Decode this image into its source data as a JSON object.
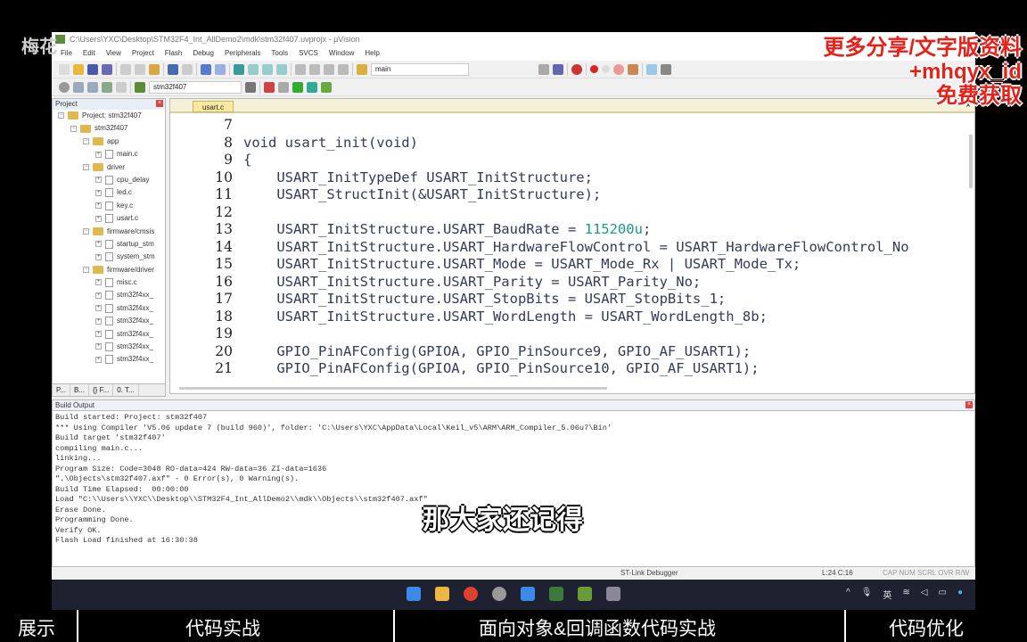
{
  "watermark": "梅花",
  "window": {
    "title": "C:\\Users\\YXC\\Desktop\\STM32F4_Int_AllDemo2\\mdk\\stm32f407.uvprojx - µVision"
  },
  "menu": [
    "File",
    "Edit",
    "View",
    "Project",
    "Flash",
    "Debug",
    "Peripherals",
    "Tools",
    "SVCS",
    "Window",
    "Help"
  ],
  "toolbar": {
    "find_combo": "main",
    "target_combo": "stm32f407"
  },
  "project": {
    "title": "Project",
    "items": [
      {
        "label": "Project: stm32f407",
        "type": "root",
        "level": 0
      },
      {
        "label": "stm32f407",
        "type": "folder",
        "level": 1
      },
      {
        "label": "app",
        "type": "folder",
        "level": 2
      },
      {
        "label": "main.c",
        "type": "file",
        "level": 3
      },
      {
        "label": "driver",
        "type": "folder",
        "level": 2
      },
      {
        "label": "cpu_delay",
        "type": "file",
        "level": 3
      },
      {
        "label": "led.c",
        "type": "file",
        "level": 3
      },
      {
        "label": "key.c",
        "type": "file",
        "level": 3
      },
      {
        "label": "usart.c",
        "type": "file",
        "level": 3
      },
      {
        "label": "firmware/cmsis",
        "type": "folder",
        "level": 2
      },
      {
        "label": "startup_stm",
        "type": "file",
        "level": 3
      },
      {
        "label": "system_stm",
        "type": "file",
        "level": 3
      },
      {
        "label": "firmware/driver",
        "type": "folder",
        "level": 2
      },
      {
        "label": "misc.c",
        "type": "file",
        "level": 3
      },
      {
        "label": "stm32f4xx_",
        "type": "file",
        "level": 3
      },
      {
        "label": "stm32f4xx_",
        "type": "file",
        "level": 3
      },
      {
        "label": "stm32f4xx_",
        "type": "file",
        "level": 3
      },
      {
        "label": "stm32f4xx_",
        "type": "file",
        "level": 3
      },
      {
        "label": "stm32f4xx_",
        "type": "file",
        "level": 3
      },
      {
        "label": "stm32f4xx_",
        "type": "file",
        "level": 3
      }
    ],
    "tabs": [
      "P...",
      "B...",
      "{} F...",
      "0. T..."
    ]
  },
  "editor": {
    "tab": "usart.c",
    "lines": [
      {
        "n": "7",
        "code": ""
      },
      {
        "n": "8",
        "code": "void usart_init(void)"
      },
      {
        "n": "9",
        "code": "{"
      },
      {
        "n": "10",
        "code": "    USART_InitTypeDef USART_InitStructure;"
      },
      {
        "n": "11",
        "code": "    USART_StructInit(&USART_InitStructure);"
      },
      {
        "n": "12",
        "code": ""
      },
      {
        "n": "13",
        "code": "    USART_InitStructure.USART_BaudRate = ",
        "num": "115200u",
        "tail": ";"
      },
      {
        "n": "14",
        "code": "    USART_InitStructure.USART_HardwareFlowControl = USART_HardwareFlowControl_No"
      },
      {
        "n": "15",
        "code": "    USART_InitStructure.USART_Mode = USART_Mode_Rx | USART_Mode_Tx;"
      },
      {
        "n": "16",
        "code": "    USART_InitStructure.USART_Parity = USART_Parity_No;"
      },
      {
        "n": "17",
        "code": "    USART_InitStructure.USART_StopBits = USART_StopBits_1;"
      },
      {
        "n": "18",
        "code": "    USART_InitStructure.USART_WordLength = USART_WordLength_8b;"
      },
      {
        "n": "19",
        "code": ""
      },
      {
        "n": "20",
        "code": "    GPIO_PinAFConfig(GPIOA, GPIO_PinSource9, GPIO_AF_USART1);"
      },
      {
        "n": "21",
        "code": "    GPIO_PinAFConfig(GPIOA, GPIO_PinSource10, GPIO_AF_USART1);"
      }
    ]
  },
  "build": {
    "title": "Build Output",
    "lines": [
      "Build started: Project: stm32f407",
      "*** Using Compiler 'V5.06 update 7 (build 960)', folder: 'C:\\Users\\YXC\\AppData\\Local\\Keil_v5\\ARM\\ARM_Compiler_5.06u7\\Bin'",
      "Build target 'stm32f407'",
      "compiling main.c...",
      "linking...",
      "Program Size: Code=3048 RO-data=424 RW-data=36 ZI-data=1636",
      "\".\\Objects\\stm32f407.axf\" - 0 Error(s), 0 Warning(s).",
      "Build Time Elapsed:  00:00:00",
      "Load \"C:\\\\Users\\\\YXC\\\\Desktop\\\\STM32F4_Int_AllDemo2\\\\mdk\\\\Objects\\\\stm32f407.axf\"",
      "Erase Done.",
      "Programming Done.",
      "Verify OK.",
      "Flash Load finished at 16:30:38"
    ]
  },
  "status": {
    "debugger": "ST-Link Debugger",
    "position": "L:24 C:16",
    "flags": "CAP NUM SCRL OVR R/W"
  },
  "tray": {
    "ime": "英"
  },
  "promo": [
    "更多分享/文字版资料",
    "+mhqyx_id",
    "免费获取"
  ],
  "subtitle": "那大家还记得",
  "chapters": [
    "展示",
    "代码实战",
    "面向对象&回调函数代码实战",
    "代码优化"
  ]
}
